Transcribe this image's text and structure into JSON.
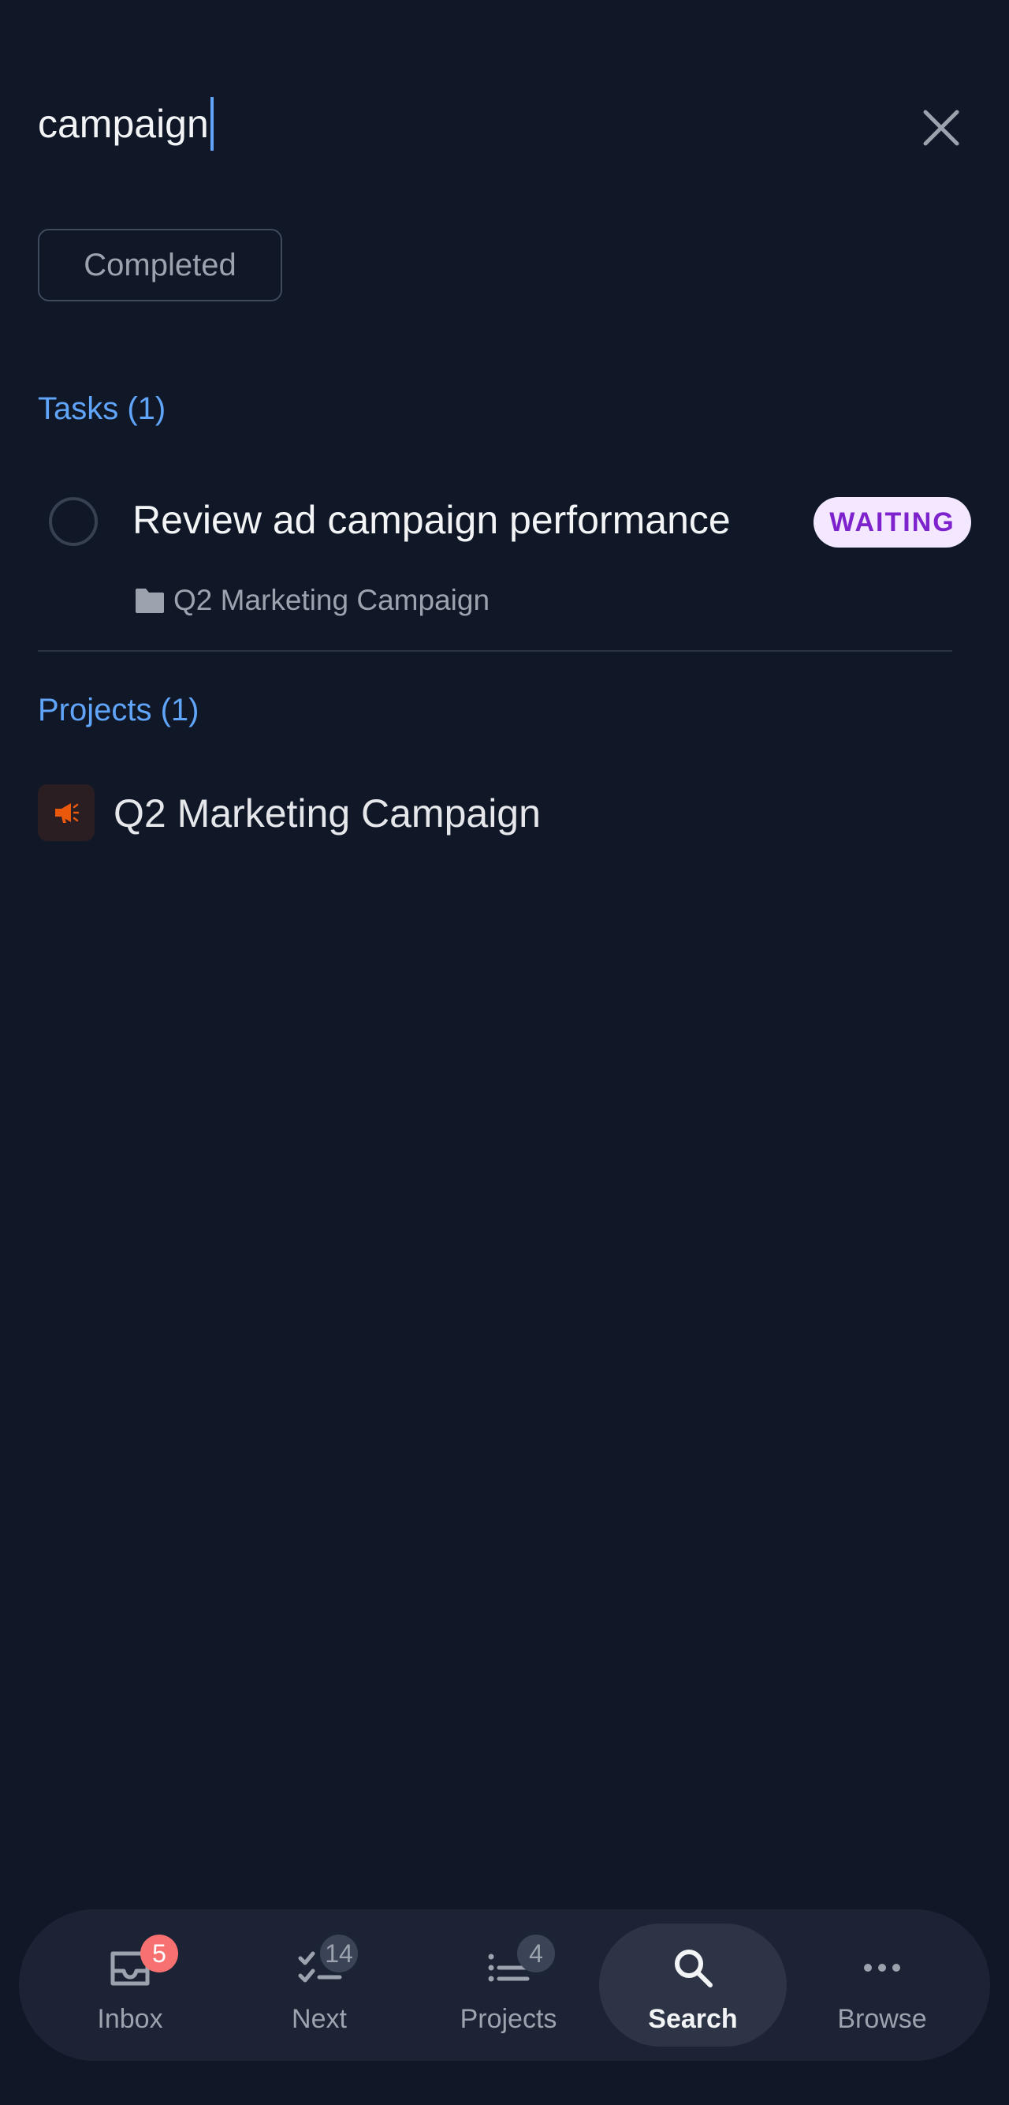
{
  "search": {
    "query": "campaign",
    "close_icon": "close-icon"
  },
  "filters": {
    "completed_label": "Completed"
  },
  "tasks_section": {
    "title": "Tasks (1)",
    "items": [
      {
        "title": "Review ad campaign performance",
        "status": "WAITING",
        "status_colors": {
          "bg": "#f3e8ff",
          "fg": "#7e22ce"
        },
        "project": "Q2 Marketing Campaign",
        "project_icon": "folder-icon"
      }
    ]
  },
  "projects_section": {
    "title": "Projects (1)",
    "items": [
      {
        "name": "Q2 Marketing Campaign",
        "icon": "megaphone-icon",
        "icon_color": "#ea580c"
      }
    ]
  },
  "bottom_nav": {
    "items": [
      {
        "label": "Inbox",
        "icon": "inbox-icon",
        "badge": "5",
        "badge_color": "#f87171"
      },
      {
        "label": "Next",
        "icon": "checklist-icon",
        "badge": "14"
      },
      {
        "label": "Projects",
        "icon": "list-icon",
        "badge": "4"
      },
      {
        "label": "Search",
        "icon": "search-icon",
        "active": true
      },
      {
        "label": "Browse",
        "icon": "more-icon"
      }
    ]
  },
  "colors": {
    "background": "#101828",
    "accent": "#60a5fa",
    "nav_background": "#1b2334"
  }
}
